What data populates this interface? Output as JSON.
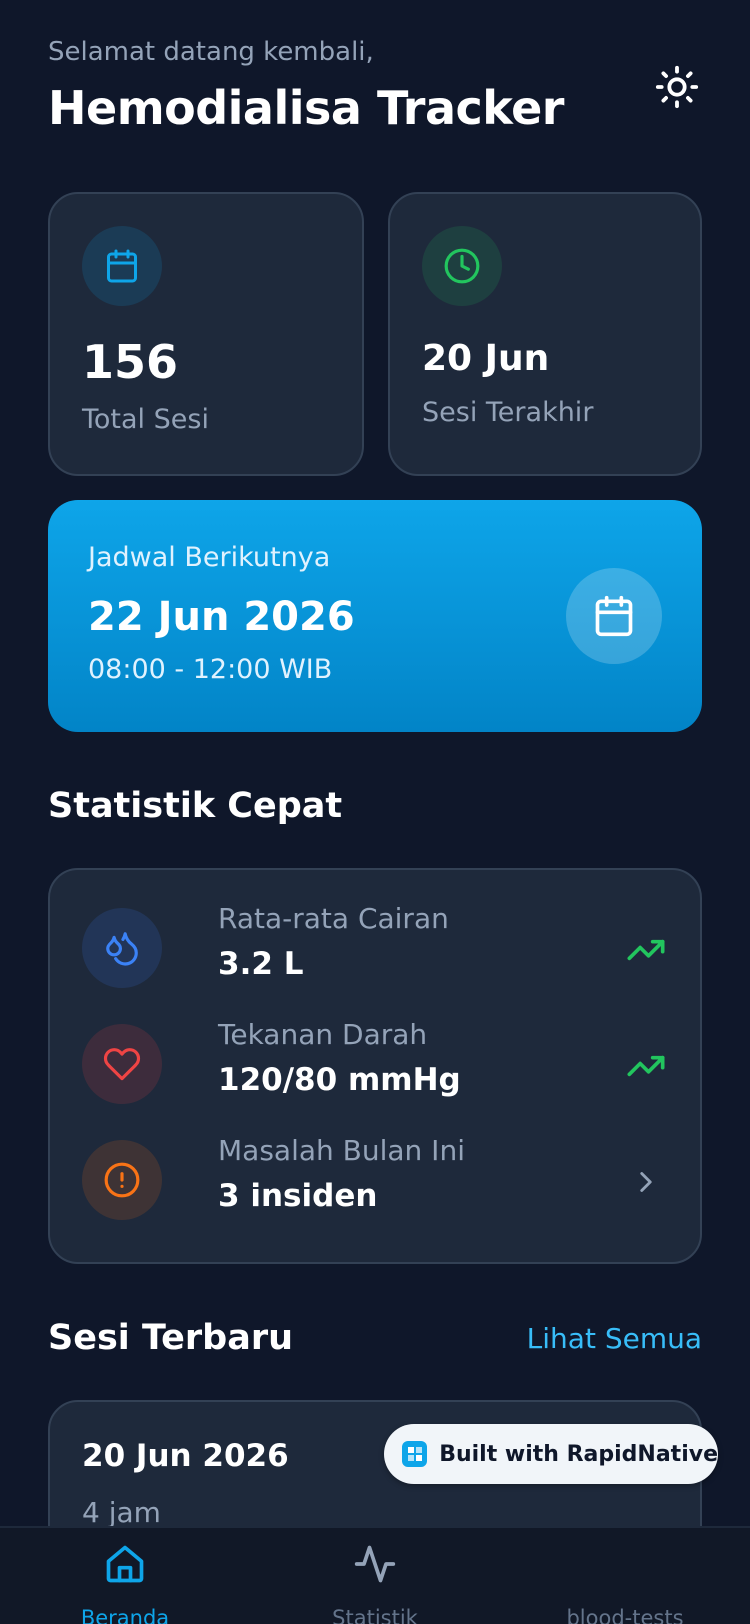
{
  "header": {
    "greeting": "Selamat datang kembali,",
    "title": "Hemodialisa Tracker",
    "theme_icon": "sun-icon"
  },
  "stats": {
    "total_sessions": {
      "value": "156",
      "label": "Total Sesi",
      "icon": "calendar-icon",
      "color": "#0ea5e9"
    },
    "last_session": {
      "value": "20 Jun",
      "label": "Sesi Terakhir",
      "icon": "clock-icon",
      "color": "#22c55e"
    }
  },
  "next_schedule": {
    "label": "Jadwal Berikutnya",
    "date": "22 Jun 2026",
    "time": "08:00 - 12:00 WIB",
    "icon": "calendar-icon"
  },
  "quick_stats": {
    "title": "Statistik Cepat",
    "items": [
      {
        "label": "Rata-rata Cairan",
        "value": "3.2 L",
        "icon": "droplets-icon",
        "trail_icon": "trending-up-icon",
        "color": "#3b82f6"
      },
      {
        "label": "Tekanan Darah",
        "value": "120/80 mmHg",
        "icon": "heart-icon",
        "trail_icon": "trending-up-icon",
        "color": "#ef4444"
      },
      {
        "label": "Masalah Bulan Ini",
        "value": "3 insiden",
        "icon": "alert-circle-icon",
        "trail_icon": "chevron-right-icon",
        "color": "#f97316"
      }
    ]
  },
  "recent_sessions": {
    "title": "Sesi Terbaru",
    "see_all": "Lihat Semua",
    "items": [
      {
        "date": "20 Jun 2026",
        "duration": "4 jam"
      }
    ]
  },
  "badge": {
    "text": "Built with RapidNative"
  },
  "tabbar": {
    "tabs": [
      {
        "label": "Beranda",
        "icon": "home-icon",
        "active": true
      },
      {
        "label": "Statistik",
        "icon": "activity-icon",
        "active": false
      },
      {
        "label": "blood-tests",
        "icon": "",
        "active": false
      }
    ]
  },
  "colors": {
    "background": "#0f172a",
    "card": "#1e293b",
    "accent": "#0ea5e9",
    "positive": "#22c55e",
    "muted_text": "#94a3b8"
  }
}
